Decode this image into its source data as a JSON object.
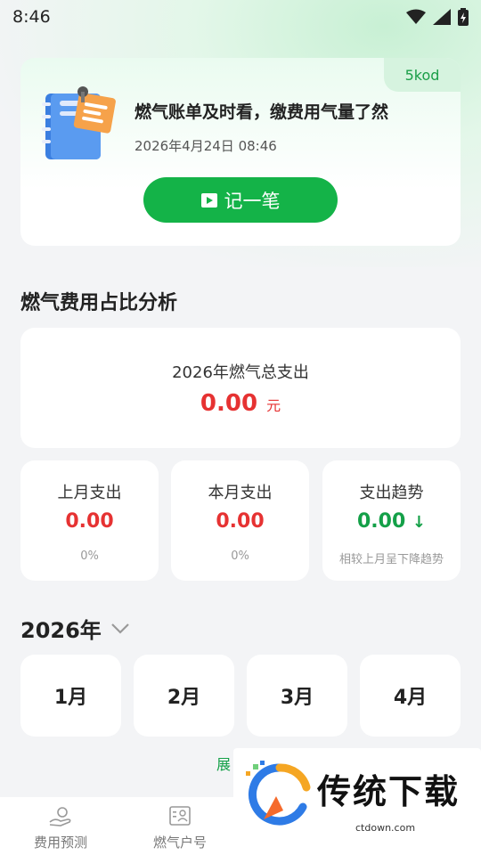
{
  "status_bar": {
    "time": "8:46"
  },
  "hero": {
    "tag": "5kod",
    "title": "燃气账单及时看，缴费用气量了然",
    "date": "2026年4月24日 08:46",
    "record_button": "记一笔"
  },
  "analysis": {
    "section_title": "燃气费用占比分析",
    "total_label": "2026年燃气总支出",
    "total_value": "0.00",
    "total_unit": "元",
    "last_month": {
      "label": "上月支出",
      "value": "0.00",
      "percent": "0%"
    },
    "this_month": {
      "label": "本月支出",
      "value": "0.00",
      "percent": "0%"
    },
    "trend": {
      "label": "支出趋势",
      "value": "0.00",
      "arrow": "↓",
      "note": "相较上月呈下降趋势"
    }
  },
  "calendar": {
    "year": "2026年",
    "months": [
      "1月",
      "2月",
      "3月",
      "4月"
    ],
    "expand": "展"
  },
  "tabbar": {
    "items": [
      {
        "label": "费用预测",
        "icon": "hand-coin-icon"
      },
      {
        "label": "燃气户号",
        "icon": "id-card-icon"
      }
    ]
  },
  "watermark": {
    "name": "传统下载",
    "url": "ctdown.com"
  },
  "colors": {
    "accent": "#14b348",
    "expense": "#e63232",
    "trend": "#14a048"
  }
}
